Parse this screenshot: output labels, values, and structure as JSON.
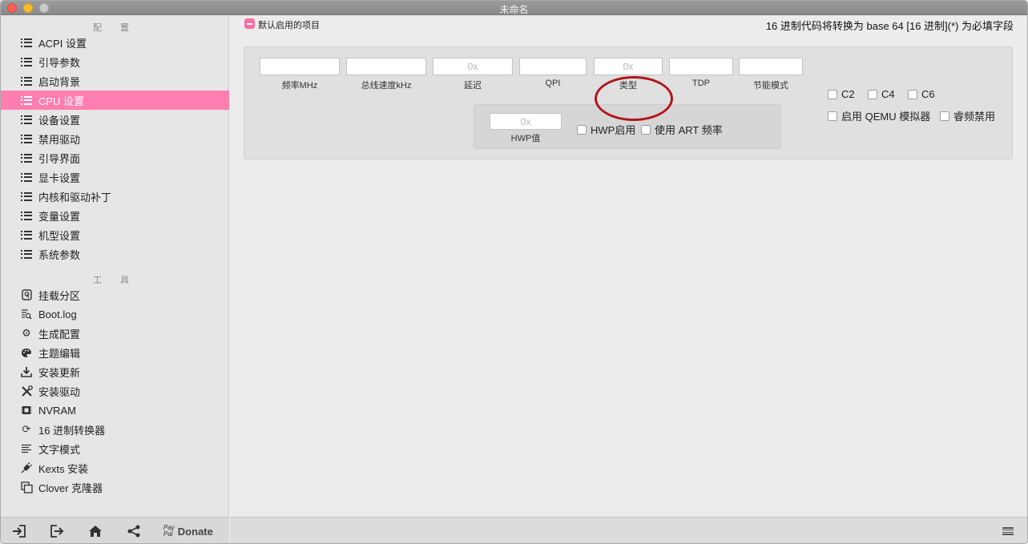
{
  "window": {
    "title": "未命名"
  },
  "sidebar": {
    "config_header": "配 置",
    "config_items": [
      {
        "label": "ACPI 设置",
        "icon": "list-icon"
      },
      {
        "label": "引导参数",
        "icon": "list-icon"
      },
      {
        "label": "启动背景",
        "icon": "list-icon"
      },
      {
        "label": "CPU 设置",
        "icon": "list-icon",
        "selected": true
      },
      {
        "label": "设备设置",
        "icon": "list-icon"
      },
      {
        "label": "禁用驱动",
        "icon": "list-icon"
      },
      {
        "label": "引导界面",
        "icon": "list-icon"
      },
      {
        "label": "显卡设置",
        "icon": "list-icon"
      },
      {
        "label": "内核和驱动补丁",
        "icon": "list-icon"
      },
      {
        "label": "变量设置",
        "icon": "list-icon"
      },
      {
        "label": "机型设置",
        "icon": "list-icon"
      },
      {
        "label": "系统参数",
        "icon": "list-icon"
      }
    ],
    "tools_header": "工 具",
    "tool_items": [
      {
        "label": "挂载分区",
        "icon": "disk-icon"
      },
      {
        "label": "Boot.log",
        "icon": "log-search-icon"
      },
      {
        "label": "生成配置",
        "icon": "gears-icon"
      },
      {
        "label": "主题编辑",
        "icon": "palette-icon"
      },
      {
        "label": "安装更新",
        "icon": "download-icon"
      },
      {
        "label": "安装驱动",
        "icon": "tools-icon"
      },
      {
        "label": "NVRAM",
        "icon": "chip-icon"
      },
      {
        "label": "16 进制转换器",
        "icon": "refresh-icon"
      },
      {
        "label": "文字模式",
        "icon": "text-icon"
      },
      {
        "label": "Kexts 安装",
        "icon": "plug-icon"
      },
      {
        "label": "Clover 克隆器",
        "icon": "clone-icon"
      }
    ],
    "footer": {
      "donate_label": "Donate",
      "paypal_line1": "Pay",
      "paypal_line2": "Pal"
    }
  },
  "main": {
    "default_label": "默认启用的项目",
    "hint": "16 进制代码将转换为 base 64 [16 进制](*) 为必填字段",
    "fields": [
      {
        "caption": "频率MHz",
        "value": "",
        "placeholder": ""
      },
      {
        "caption": "总线速度kHz",
        "value": "",
        "placeholder": ""
      },
      {
        "caption": "延迟",
        "value": "",
        "placeholder": "0x"
      },
      {
        "caption": "QPI",
        "value": "",
        "placeholder": ""
      },
      {
        "caption": "类型",
        "value": "",
        "placeholder": "0x"
      },
      {
        "caption": "TDP",
        "value": "",
        "placeholder": ""
      },
      {
        "caption": "节能模式",
        "value": "",
        "placeholder": ""
      }
    ],
    "hwp": {
      "caption": "HWP值",
      "placeholder": "0x",
      "enable_label": "HWP启用",
      "art_label": "使用 ART 频率"
    },
    "cstates": {
      "c2": "C2",
      "c4": "C4",
      "c6": "C6"
    },
    "qemu_label": "启用 QEMU 模拟器",
    "turbo_label": "睿频禁用"
  },
  "colors": {
    "accent": "#ff7eb0",
    "annotation": "#b0161b"
  }
}
